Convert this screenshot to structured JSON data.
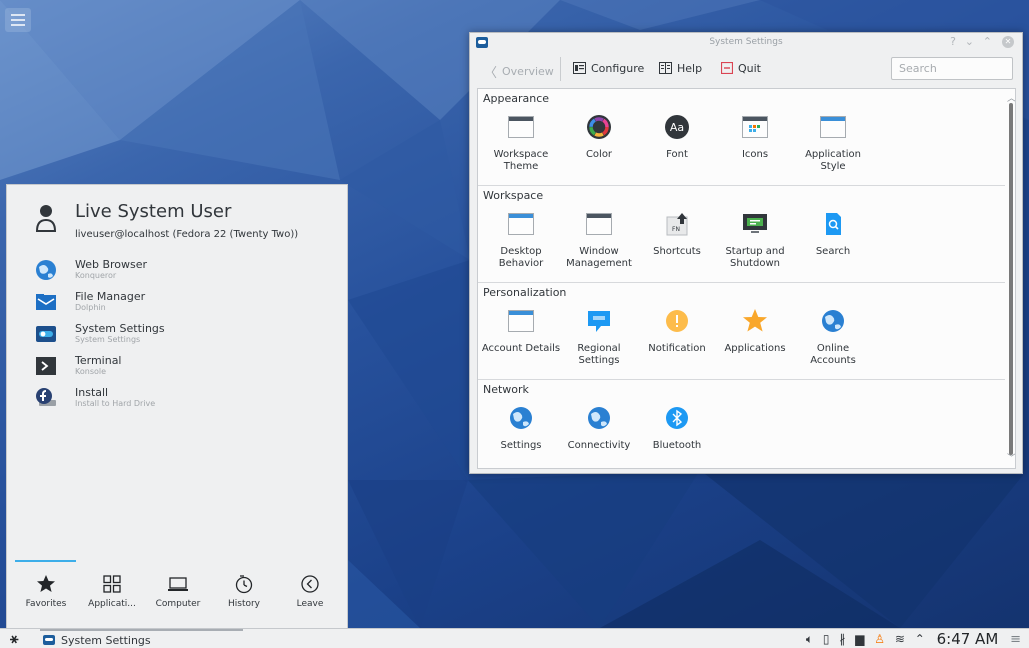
{
  "window": {
    "title": "System Settings",
    "controls": {
      "help": "?",
      "minimize": "⌄",
      "maximize": "⌃",
      "close": "✕"
    }
  },
  "toolbar": {
    "overview": "Overview",
    "configure": "Configure",
    "help": "Help",
    "quit": "Quit",
    "search_placeholder": "Search"
  },
  "categories": [
    {
      "title": "Appearance",
      "modules": [
        {
          "label": "Workspace Theme",
          "icon": "window-icon"
        },
        {
          "label": "Color",
          "icon": "color-wheel-icon"
        },
        {
          "label": "Font",
          "icon": "font-icon"
        },
        {
          "label": "Icons",
          "icon": "icons-icon"
        },
        {
          "label": "Application Style",
          "icon": "window-icon"
        }
      ]
    },
    {
      "title": "Workspace",
      "modules": [
        {
          "label": "Desktop Behavior",
          "icon": "window-icon"
        },
        {
          "label": "Window Management",
          "icon": "window-icon"
        },
        {
          "label": "Shortcuts",
          "icon": "shortcuts-icon"
        },
        {
          "label": "Startup and Shutdown",
          "icon": "monitor-icon"
        },
        {
          "label": "Search",
          "icon": "search-doc-icon"
        }
      ]
    },
    {
      "title": "Personalization",
      "modules": [
        {
          "label": "Account Details",
          "icon": "window-icon"
        },
        {
          "label": "Regional Settings",
          "icon": "chat-icon"
        },
        {
          "label": "Notification",
          "icon": "warning-icon"
        },
        {
          "label": "Applications",
          "icon": "star-icon"
        },
        {
          "label": "Online Accounts",
          "icon": "globe-icon"
        }
      ]
    },
    {
      "title": "Network",
      "modules": [
        {
          "label": "Settings",
          "icon": "globe-icon"
        },
        {
          "label": "Connectivity",
          "icon": "globe-icon"
        },
        {
          "label": "Bluetooth",
          "icon": "bluetooth-icon"
        }
      ]
    }
  ],
  "launcher": {
    "user_name": "Live System User",
    "user_host": "liveuser@localhost (Fedora 22 (Twenty Two))",
    "favorites": [
      {
        "name": "Web Browser",
        "desc": "Konqueror",
        "icon": "globe-icon"
      },
      {
        "name": "File Manager",
        "desc": "Dolphin",
        "icon": "folder-icon"
      },
      {
        "name": "System Settings",
        "desc": "System Settings",
        "icon": "settings-toggle-icon"
      },
      {
        "name": "Terminal",
        "desc": "Konsole",
        "icon": "terminal-icon"
      },
      {
        "name": "Install",
        "desc": "Install to Hard Drive",
        "icon": "fedora-install-icon"
      }
    ],
    "tabs": [
      {
        "label": "Favorites",
        "icon": "star-icon"
      },
      {
        "label": "Applicati...",
        "icon": "grid-icon"
      },
      {
        "label": "Computer",
        "icon": "laptop-icon"
      },
      {
        "label": "History",
        "icon": "history-icon"
      },
      {
        "label": "Leave",
        "icon": "leave-icon"
      }
    ],
    "active_tab": "Favorites"
  },
  "taskbar": {
    "task_label": "System Settings",
    "clock": "6:47 AM",
    "tray": [
      "volume-icon",
      "clipboard-icon",
      "bluetooth-icon",
      "device-notifier-icon",
      "updates-icon",
      "wifi-icon",
      "expand-arrow-icon",
      "menu-icon"
    ]
  },
  "colors": {
    "accent": "#3daee9",
    "window_bg": "#eff0f1",
    "content_bg": "#fcfcfc",
    "desktop": "#1d3f84"
  }
}
